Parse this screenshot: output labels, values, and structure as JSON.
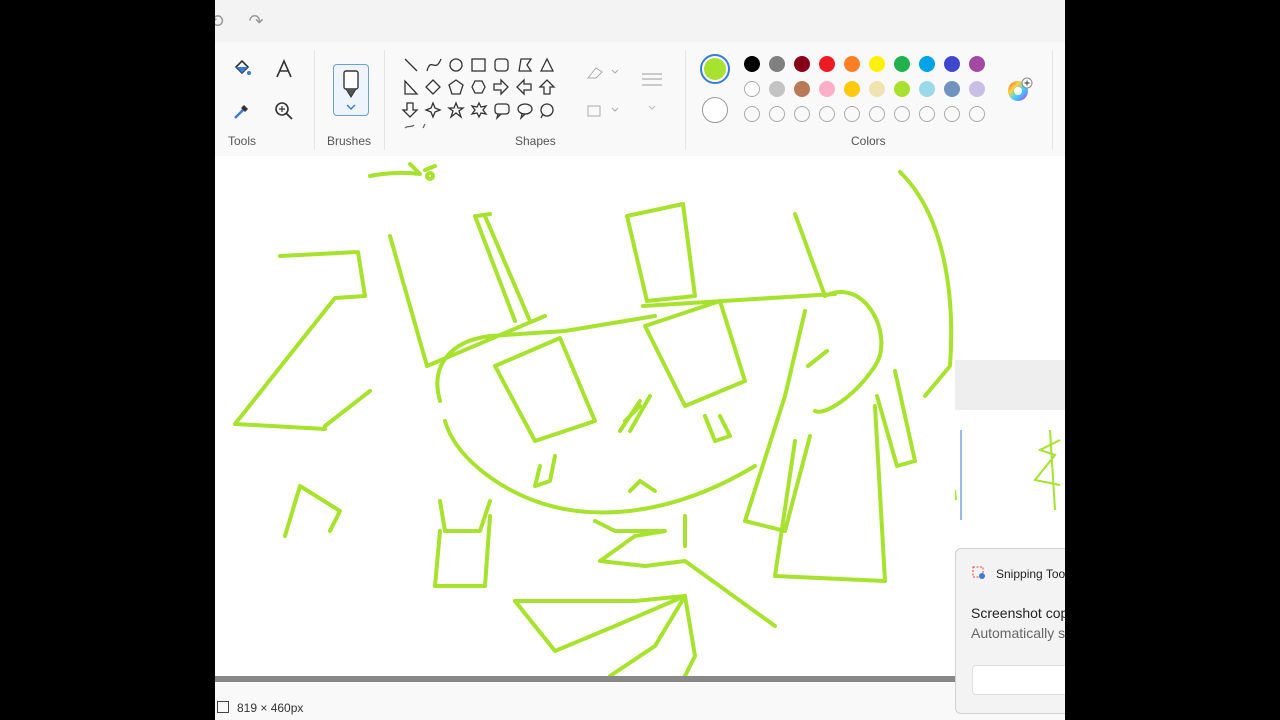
{
  "ribbon": {
    "tools_label": "Tools",
    "brushes_label": "Brushes",
    "shapes_label": "Shapes",
    "colors_label": "Colors"
  },
  "colors": {
    "selected_primary": "#a6e22e",
    "selected_secondary": "#ffffff",
    "palette_row1": [
      "#000000",
      "#7f7f7f",
      "#880015",
      "#ed1c24",
      "#ff7f27",
      "#fff200",
      "#22b14c",
      "#00a2e8",
      "#3f48cc",
      "#a349a4"
    ],
    "palette_row2": [
      "#ffffff",
      "#c3c3c3",
      "#b97a57",
      "#ffaec9",
      "#ffc90e",
      "#efe4b0",
      "#a6e22e",
      "#99d9ea",
      "#7092be",
      "#c8bfe7"
    ],
    "palette_row3_count": 10
  },
  "shape_icons": [
    "line-icon",
    "curve-icon",
    "oval-icon",
    "rectangle-icon",
    "rounded-rectangle-icon",
    "polygon-icon",
    "triangle-icon",
    "right-triangle-icon",
    "diamond-icon",
    "pentagon-icon",
    "hexagon-icon",
    "right-arrow-icon",
    "left-arrow-icon",
    "up-arrow-icon",
    "down-arrow-icon",
    "four-point-star-icon",
    "five-point-star-icon",
    "six-point-star-icon",
    "rounded-callout-icon",
    "oval-callout-icon",
    "cloud-callout-icon"
  ],
  "status": {
    "canvas_size": "819 × 460px"
  },
  "toast": {
    "app_name": "Snipping Too",
    "title": "Screenshot cop",
    "body": "Automatically s"
  },
  "drawing": {
    "stroke_color": "#a6e22e"
  }
}
